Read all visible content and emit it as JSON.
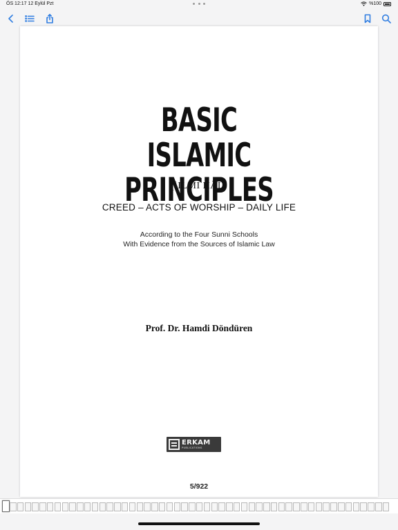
{
  "status_bar": {
    "time_date": "ÖS 12:17  12 Eylül Pzt",
    "battery_text": "%100"
  },
  "toolbar": {
    "left_icons": [
      "chevron-left-icon",
      "list-icon",
      "share-icon"
    ],
    "right_icons": [
      "bookmark-icon",
      "search-icon"
    ],
    "accent_color": "#2f7de1"
  },
  "page": {
    "title_line_1": "BASIC",
    "title_line_2": "ISLAMIC PRINCIPLES",
    "transliteration": "(ʿILMI ḤĀL)",
    "subtitle": "CREED – ACTS OF WORSHIP – DAILY LIFE",
    "description_line_1": "According to the Four Sunni Schools",
    "description_line_2": "With Evidence from the Sources of Islamic Law",
    "author": "Prof. Dr. Hamdi Döndüren",
    "publisher_name": "ERKAM",
    "publisher_sub": "PUBLICATIONS",
    "page_number": "5/922"
  }
}
